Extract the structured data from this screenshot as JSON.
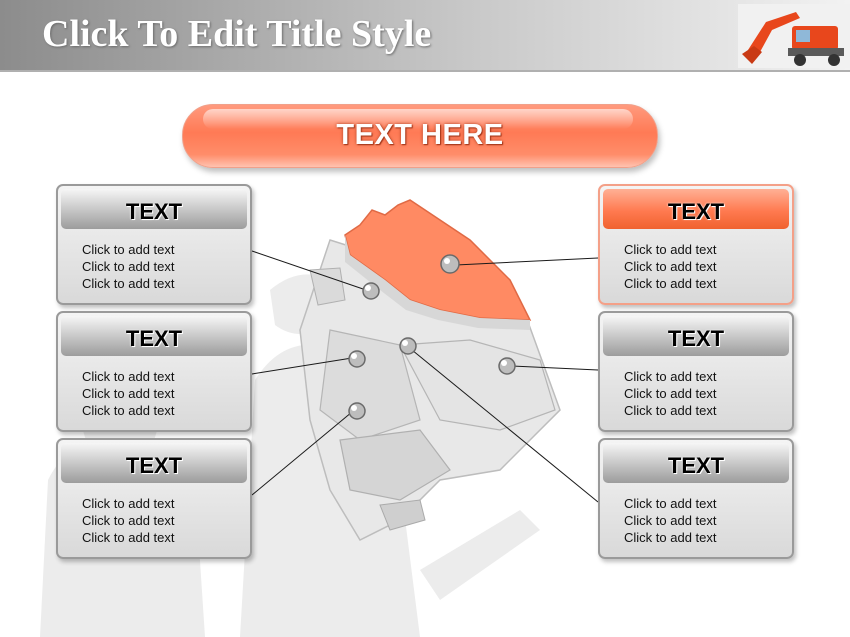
{
  "title": "Click To Edit Title Style",
  "banner": "TEXT HERE",
  "boxes": [
    {
      "title": "TEXT",
      "lines": [
        "Click to add text",
        "Click to add text",
        "Click to add text"
      ]
    },
    {
      "title": "TEXT",
      "lines": [
        "Click to add text",
        "Click to add text",
        "Click to add text"
      ]
    },
    {
      "title": "TEXT",
      "lines": [
        "Click to add text",
        "Click to add text",
        "Click to add text"
      ]
    },
    {
      "title": "TEXT",
      "lines": [
        "Click to add text",
        "Click to add text",
        "Click to add text"
      ]
    },
    {
      "title": "TEXT",
      "lines": [
        "Click to add text",
        "Click to add text",
        "Click to add text"
      ]
    },
    {
      "title": "TEXT",
      "lines": [
        "Click to add text",
        "Click to add text",
        "Click to add text"
      ]
    }
  ],
  "colors": {
    "accent": "#ff7a55",
    "title_bar_start": "#8c8c8c",
    "excavator": "#e8471c"
  }
}
